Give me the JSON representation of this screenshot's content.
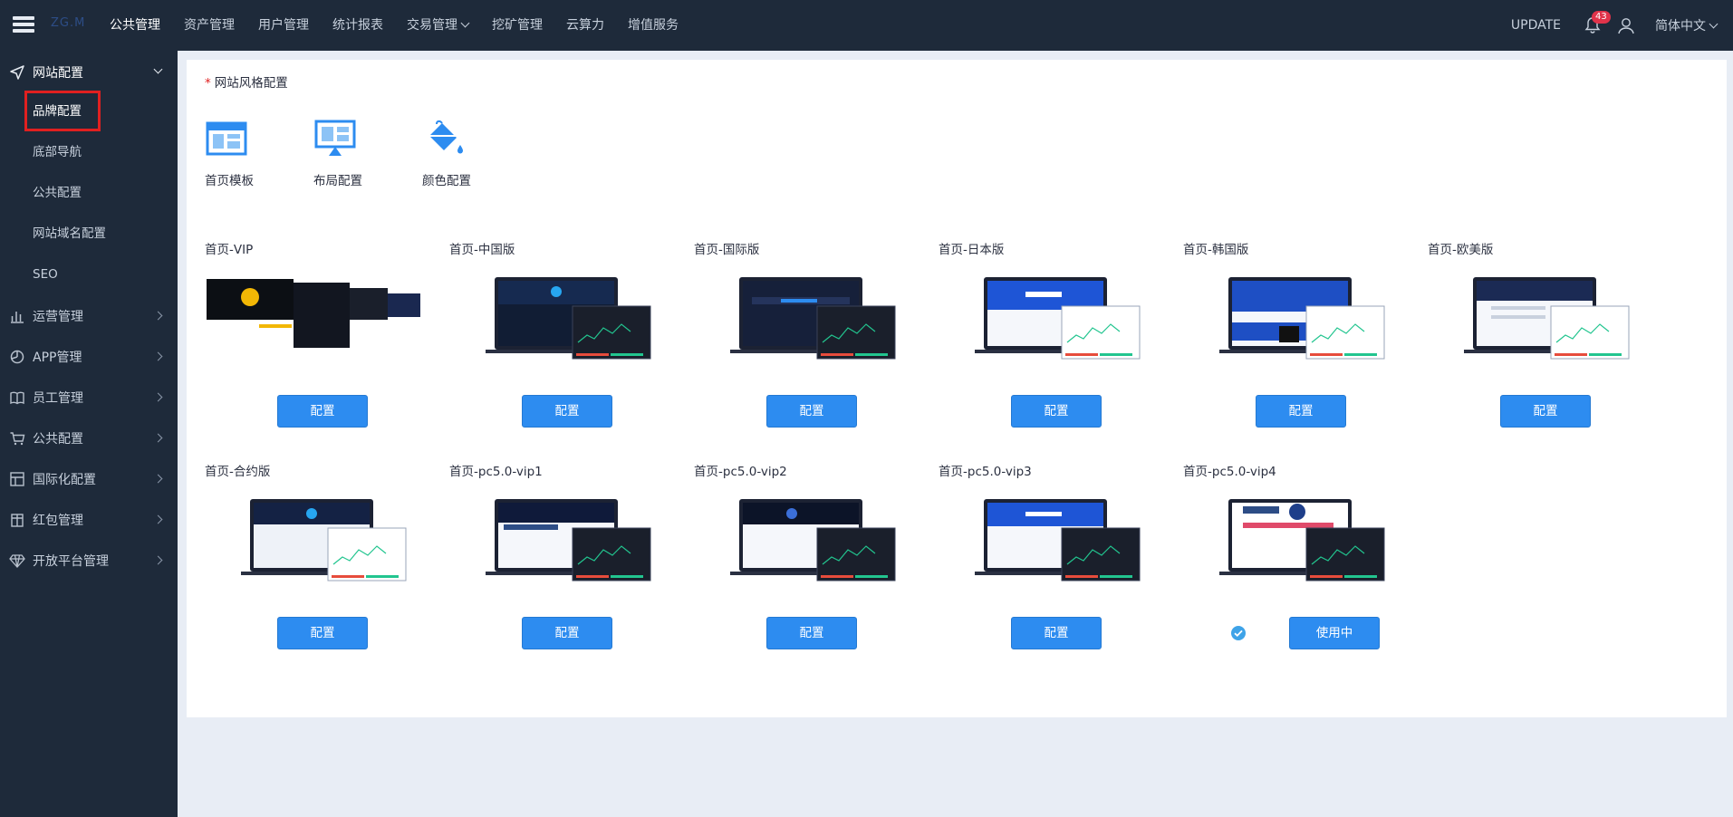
{
  "app": {
    "brand_text": "ZG.M",
    "colors": {
      "header_bg": "#1e2a3a",
      "sidebar_bg": "#1e2a3a",
      "accent": "#2d8cf0",
      "badge": "#e0334a",
      "highlight": "#e02020"
    }
  },
  "topnav": {
    "items": [
      {
        "label": "公共管理",
        "active": true
      },
      {
        "label": "资产管理"
      },
      {
        "label": "用户管理"
      },
      {
        "label": "统计报表"
      },
      {
        "label": "交易管理",
        "dropdown": true
      },
      {
        "label": "挖矿管理"
      },
      {
        "label": "云算力"
      },
      {
        "label": "增值服务"
      }
    ],
    "update_label": "UPDATE",
    "notification_count": "43",
    "language": "简体中文"
  },
  "sidebar": {
    "groups": [
      {
        "label": "网站配置",
        "icon": "send-icon",
        "open": true
      },
      {
        "label": "运营管理",
        "icon": "bar-chart-icon"
      },
      {
        "label": "APP管理",
        "icon": "pie-chart-icon"
      },
      {
        "label": "员工管理",
        "icon": "book-icon"
      },
      {
        "label": "公共配置",
        "icon": "cart-icon"
      },
      {
        "label": "国际化配置",
        "icon": "grid-icon"
      },
      {
        "label": "红包管理",
        "icon": "package-icon"
      },
      {
        "label": "开放平台管理",
        "icon": "diamond-icon"
      }
    ],
    "subitems": [
      {
        "label": "品牌配置",
        "active": true
      },
      {
        "label": "底部导航"
      },
      {
        "label": "公共配置"
      },
      {
        "label": "网站域名配置"
      },
      {
        "label": "SEO"
      }
    ]
  },
  "main": {
    "section_title": "网站风格配置",
    "tools": [
      {
        "label": "首页模板",
        "icon": "template-icon"
      },
      {
        "label": "布局配置",
        "icon": "layout-icon"
      },
      {
        "label": "颜色配置",
        "icon": "paint-bucket-icon"
      }
    ],
    "templates": [
      {
        "name": "首页-VIP",
        "button": "配置"
      },
      {
        "name": "首页-中国版",
        "button": "配置"
      },
      {
        "name": "首页-国际版",
        "button": "配置"
      },
      {
        "name": "首页-日本版",
        "button": "配置"
      },
      {
        "name": "首页-韩国版",
        "button": "配置"
      },
      {
        "name": "首页-欧美版",
        "button": "配置"
      },
      {
        "name": "首页-合约版",
        "button": "配置"
      },
      {
        "name": "首页-pc5.0-vip1",
        "button": "配置"
      },
      {
        "name": "首页-pc5.0-vip2",
        "button": "配置"
      },
      {
        "name": "首页-pc5.0-vip3",
        "button": "配置"
      },
      {
        "name": "首页-pc5.0-vip4",
        "button": "使用中",
        "in_use": true
      }
    ]
  }
}
